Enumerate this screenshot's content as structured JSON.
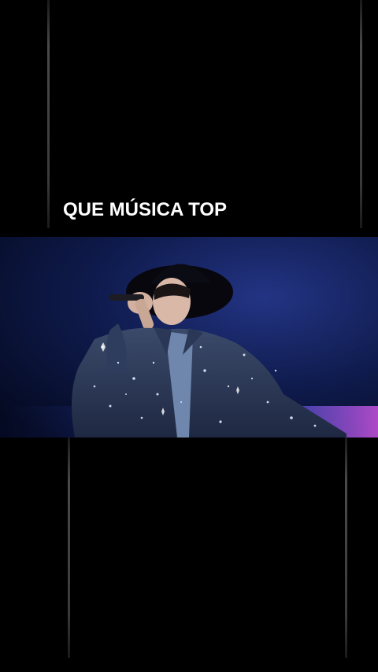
{
  "caption": {
    "text": "QUE MÚSICA TOP"
  },
  "photo": {
    "subject": "performer-singing-into-microphone",
    "background_color": "#0d1844",
    "jacket_color": "#2b3a5c",
    "hat_color": "#0a0a12"
  }
}
